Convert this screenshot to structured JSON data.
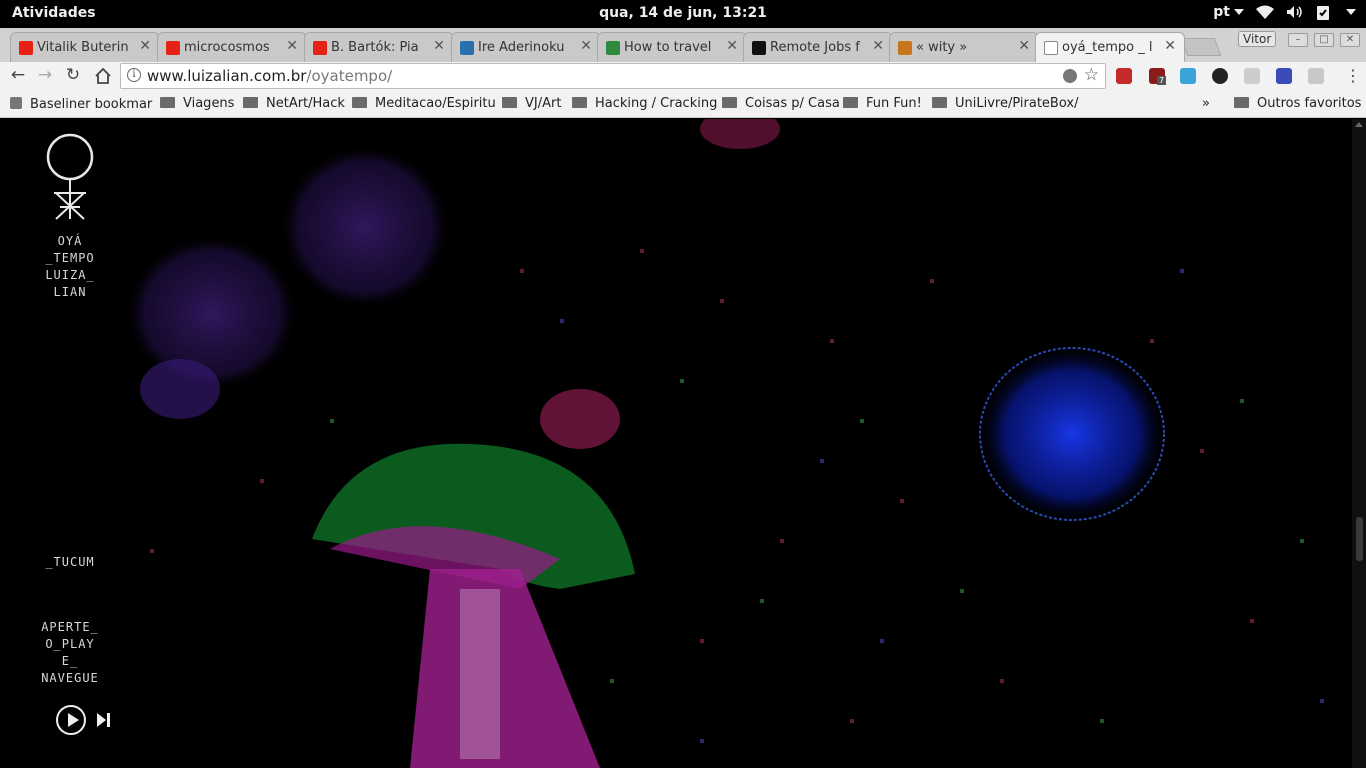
{
  "system_bar": {
    "activities": "Atividades",
    "clock": "qua, 14 de jun, 13:21",
    "language": "pt",
    "icons": [
      "wifi-icon",
      "volume-icon",
      "clipboard-icon",
      "power-menu-icon"
    ]
  },
  "tabs": [
    {
      "label": "Vitalik Buterin",
      "favicon": "youtube-icon",
      "color": "#e62117"
    },
    {
      "label": "microcosmos",
      "favicon": "youtube-icon",
      "color": "#e62117"
    },
    {
      "label": "B. Bartók: Pia",
      "favicon": "youtube-icon",
      "color": "#e62117"
    },
    {
      "label": "Ire Aderinoku",
      "favicon": "avatar-icon",
      "color": "#2a6fb0"
    },
    {
      "label": "How to travel",
      "favicon": "site-icon",
      "color": "#2f8a3c"
    },
    {
      "label": "Remote Jobs f",
      "favicon": "site-icon",
      "color": "#111111"
    },
    {
      "label": "« wity »",
      "favicon": "star-site-icon",
      "color": "#c9761b"
    },
    {
      "label": "oyá_tempo _ l",
      "favicon": "page-icon",
      "color": "#ffffff",
      "active": true
    }
  ],
  "profile_name": "Vitor",
  "omnibox": {
    "domain": "www.luizalian.com.br",
    "path": "/oyatempo/"
  },
  "bookmarks": [
    {
      "label": "Baseliner bookmar",
      "type": "page"
    },
    {
      "label": "Viagens",
      "type": "folder"
    },
    {
      "label": "NetArt/Hack",
      "type": "folder"
    },
    {
      "label": "Meditacao/Espiritu",
      "type": "folder"
    },
    {
      "label": "VJ/Art",
      "type": "folder"
    },
    {
      "label": "Hacking / Cracking",
      "type": "folder"
    },
    {
      "label": "Coisas p/ Casa",
      "type": "folder"
    },
    {
      "label": "Fun Fun!",
      "type": "folder"
    },
    {
      "label": "UniLivre/PirateBox/",
      "type": "folder"
    }
  ],
  "bookmarks_overflow": "»",
  "other_bookmarks": "Outros favoritos",
  "extension_badge": "7",
  "page": {
    "title_lines": [
      "OYÁ",
      "_TEMPO",
      "LUIZA_",
      "LIAN"
    ],
    "tucum": "_TUCUM",
    "instruction_lines": [
      "APERTE_",
      "O_PLAY",
      "E_",
      "NAVEGUE"
    ]
  }
}
